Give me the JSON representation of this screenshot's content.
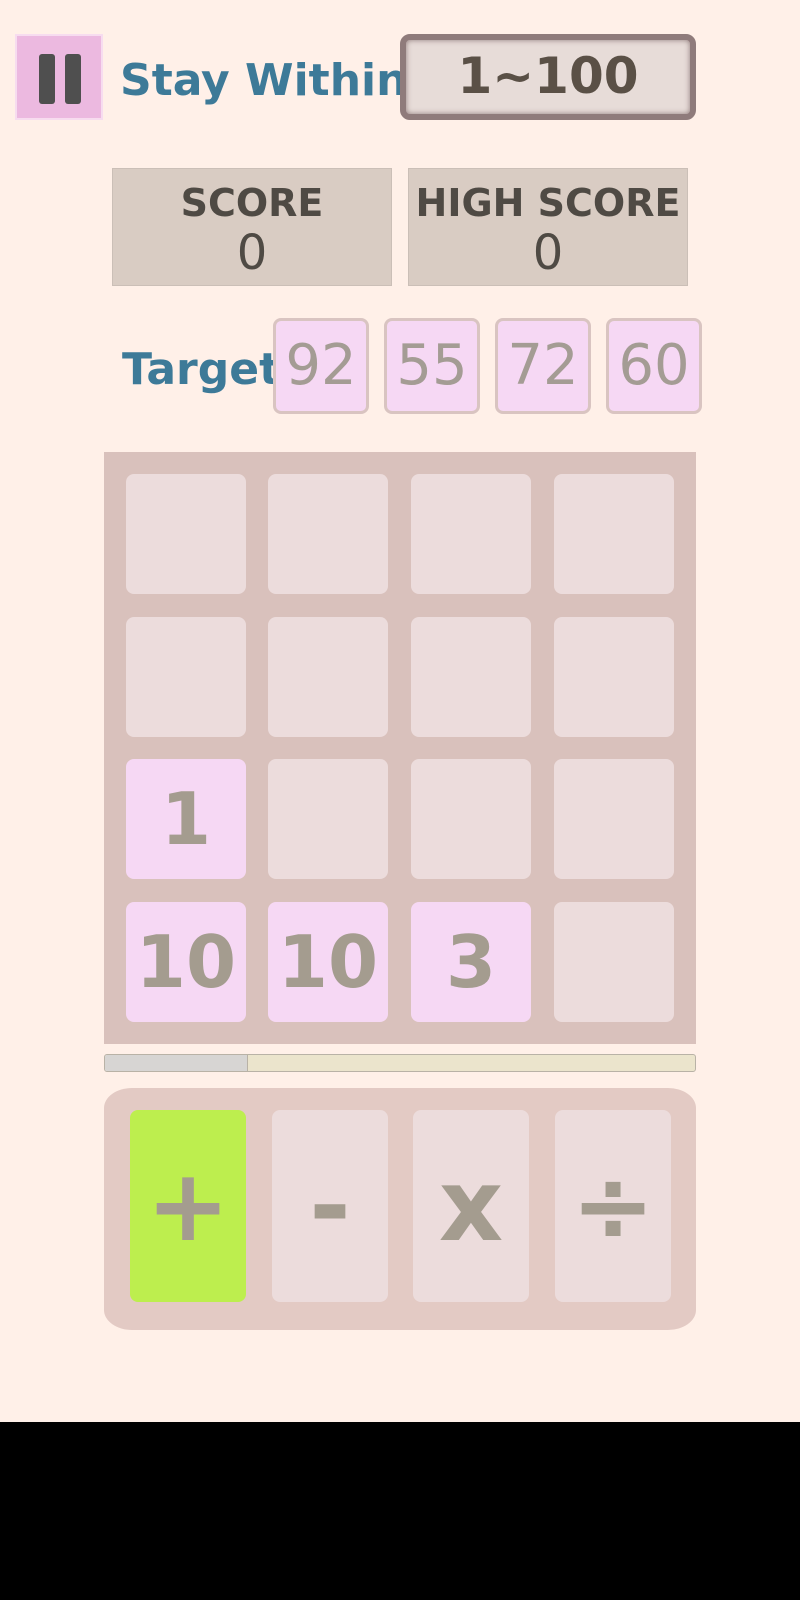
{
  "header": {
    "stay_label": "Stay Within",
    "range": "1~100"
  },
  "scores": {
    "score_label": "SCORE",
    "score": "0",
    "high_score_label": "HIGH SCORE",
    "high_score": "0"
  },
  "targets": {
    "label": "Target",
    "values": [
      "92",
      "55",
      "72",
      "60"
    ]
  },
  "board": {
    "rows": [
      [
        "",
        "",
        "",
        ""
      ],
      [
        "",
        "",
        "",
        ""
      ],
      [
        "1",
        "",
        "",
        ""
      ],
      [
        "10",
        "10",
        "3",
        ""
      ]
    ]
  },
  "timer": {
    "progress_fraction": 0.24
  },
  "operators": {
    "plus": "+",
    "minus": "-",
    "times": "x",
    "divide": "÷",
    "selected": "plus"
  },
  "colors": {
    "accent_text": "#3d7a98",
    "filled_tile": "#f6d8f4",
    "selected_operator": "#bdee4e",
    "pause_button": "#ecb9e0"
  }
}
